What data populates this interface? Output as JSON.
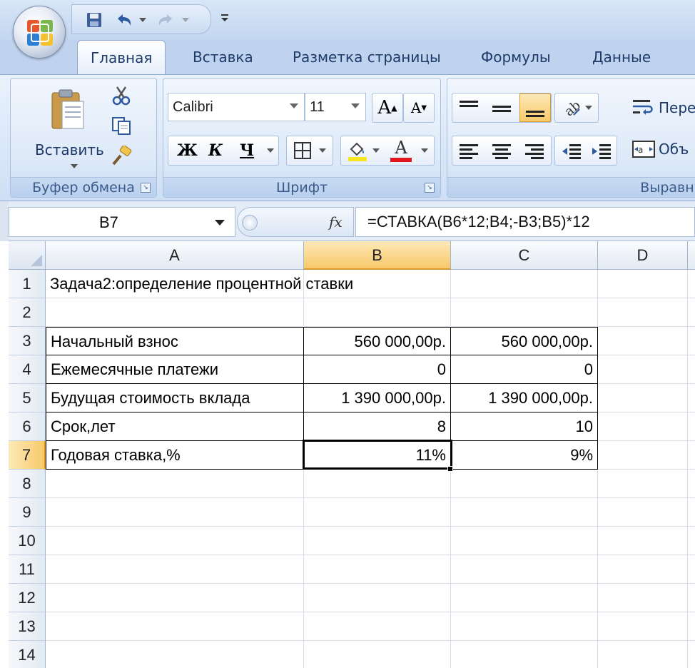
{
  "qat": {
    "save_icon": "save-icon",
    "undo_icon": "undo-icon",
    "redo_icon": "redo-icon",
    "customize_icon": "customize-qat-icon"
  },
  "tabs": [
    {
      "label": "Главная",
      "active": true
    },
    {
      "label": "Вставка",
      "active": false
    },
    {
      "label": "Разметка страницы",
      "active": false
    },
    {
      "label": "Формулы",
      "active": false
    },
    {
      "label": "Данные",
      "active": false
    }
  ],
  "ribbon": {
    "clipboard": {
      "paste_label": "Вставить",
      "group_label": "Буфер обмена"
    },
    "font": {
      "font_name": "Calibri",
      "font_size": "11",
      "bold": "Ж",
      "italic": "К",
      "underline": "Ч",
      "grow": "A",
      "shrink": "A",
      "font_color_letter": "A",
      "group_label": "Шрифт",
      "fill_color": "#f5e621",
      "font_color": "#e0171f"
    },
    "alignment": {
      "wrap_label": "Пере",
      "merge_label": "Объ",
      "group_label": "Выравни"
    }
  },
  "formula_bar": {
    "name_box": "B7",
    "fx": "fx",
    "formula": "=СТАВКА(B6*12;B4;-B3;B5)*12"
  },
  "grid": {
    "columns": [
      "A",
      "B",
      "C",
      "D"
    ],
    "selected_column": "B",
    "rows": [
      "1",
      "2",
      "3",
      "4",
      "5",
      "6",
      "7",
      "8",
      "9",
      "10",
      "11",
      "12",
      "13",
      "14"
    ],
    "selected_row": "7",
    "cells": {
      "A1": "Задача2:определение процентной ставки",
      "A3": "Начальный взнос",
      "B3": "560 000,00р.",
      "C3": "560 000,00р.",
      "A4": "Ежемесячные платежи",
      "B4": "0",
      "C4": "0",
      "A5": "Будущая стоимость вклада",
      "B5": "1 390 000,00р.",
      "C5": "1 390 000,00р.",
      "A6": "Срок,лет",
      "B6": "8",
      "C6": "10",
      "A7": "Годовая ставка,%",
      "B7": "11%",
      "C7": "9%"
    }
  }
}
